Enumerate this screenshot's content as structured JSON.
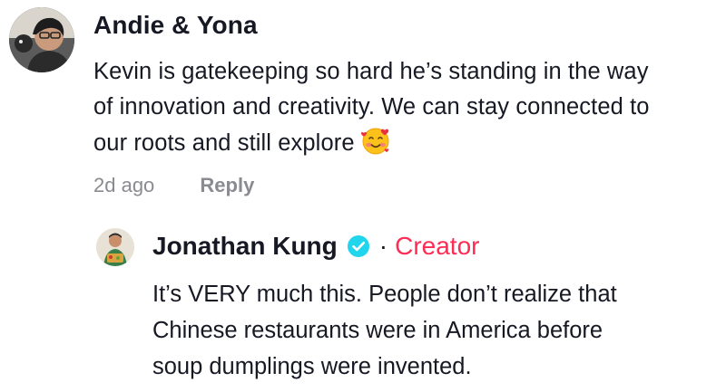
{
  "comment": {
    "author": "Andie & Yona",
    "text_lines": [
      "Kevin is gatekeeping so hard he’s standing in the way",
      "of innovation and creativity. We can stay connected to",
      "our roots and still explore"
    ],
    "emoji": "smiling-face-with-hearts-icon",
    "time": "2d ago",
    "reply_label": "Reply"
  },
  "reply": {
    "author": "Jonathan Kung",
    "dot": "·",
    "badge": "Creator",
    "text_lines": [
      "It’s VERY much this. People don’t realize that",
      "Chinese restaurants were in America before",
      "soup dumplings were invented."
    ]
  },
  "colors": {
    "accent": "#fe2c55",
    "verified": "#20d5ec",
    "meta": "#8a8b91",
    "text": "#161823"
  }
}
